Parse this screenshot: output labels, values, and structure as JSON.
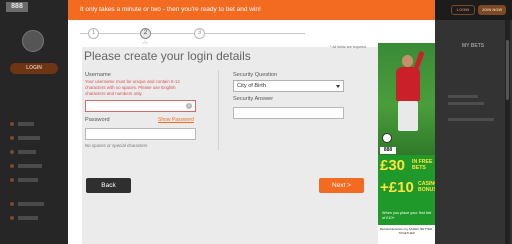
{
  "background": {
    "logo_text": "888",
    "login_label": "LOGIN",
    "top_login_label": "LOGIN",
    "top_join_label": "JOIN NOW",
    "my_bets_label": "MY BETS"
  },
  "banner": {
    "text": "It only takes a minute or two - then you're ready to bet and win!"
  },
  "steps": [
    "1",
    "2",
    "3"
  ],
  "form": {
    "title": "Please create your login details",
    "required_note": "* All fields are required",
    "username": {
      "label": "Username",
      "hint": "Your username must be unique and contain 6-12 characters with no spaces. Please use English characters and numbers only.",
      "value": "",
      "info_icon": "i"
    },
    "password": {
      "label": "Password",
      "show_label": "Show Password",
      "value": "",
      "hint": "No spaces or special characters"
    },
    "security_question": {
      "label": "Security Question",
      "selected": "City of Birth"
    },
    "security_answer": {
      "label": "Security Answer",
      "value": ""
    },
    "back_label": "Back",
    "next_label": "Next >"
  },
  "ad": {
    "brand": "888",
    "line1_amount": "£30",
    "line1_text": "IN FREE BETS",
    "line2_amount": "+£10",
    "line2_text": "CASINO BONUS",
    "when_text": "When you place your first bet of £10+",
    "footer": "BeGambleAware.org SAFER. BETTER. TOGETHER"
  },
  "colors": {
    "accent": "#f36b21",
    "back_button": "#2f2f2f",
    "error": "#d9534f",
    "ad_green": "#1f9a2a",
    "ad_yellow": "#ffe33a"
  }
}
